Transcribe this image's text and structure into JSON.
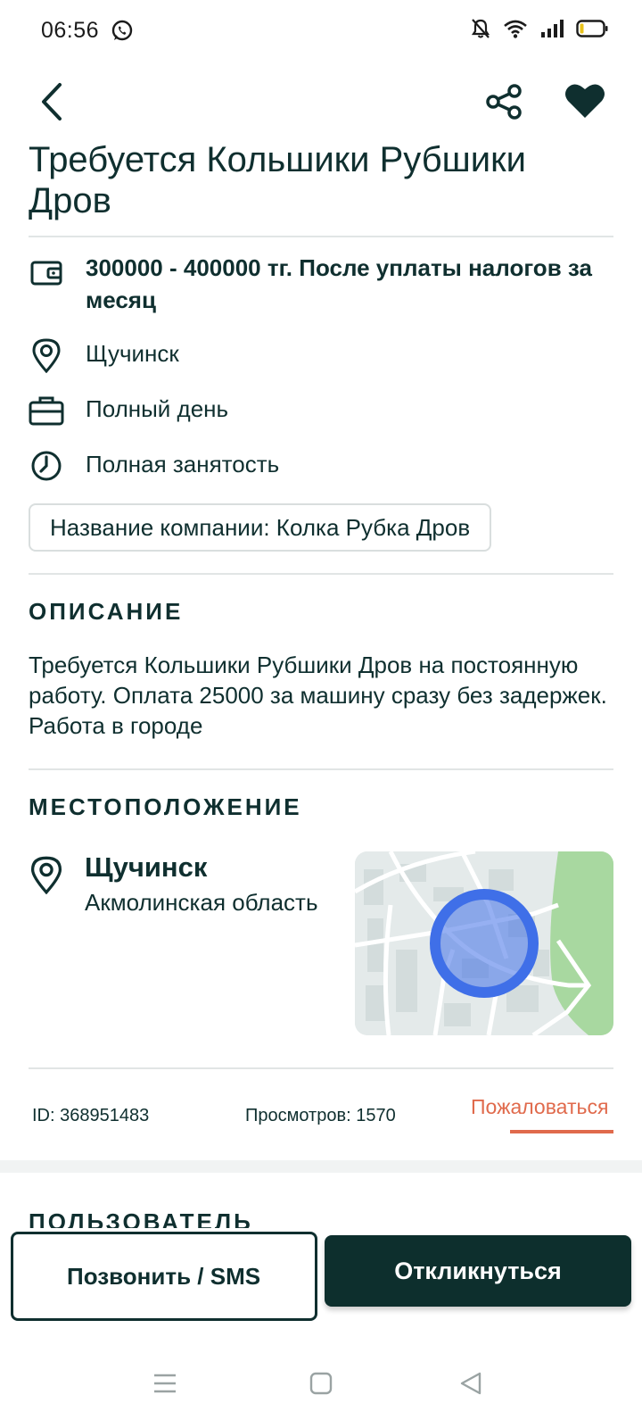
{
  "status_bar": {
    "time": "06:56"
  },
  "job": {
    "title": "Требуется Кольшики Рубшики Дров",
    "salary": "300000 - 400000 тг. После уплаты налогов за месяц",
    "city": "Щучинск",
    "schedule": "Полный день",
    "employment": "Полная занятость",
    "company_chip": "Название компании: Колка Рубка Дров"
  },
  "description": {
    "heading": "ОПИСАНИЕ",
    "text": "Требуется Кольшики Рубшики Дров на постоянную работу. Оплата 25000 за машину сразу без задержек. Работа в городе"
  },
  "location": {
    "heading": "МЕСТОПОЛОЖЕНИЕ",
    "city": "Щучинск",
    "region": "Акмолинская область"
  },
  "meta": {
    "id": "ID: 368951483",
    "views": "Просмотров: 1570",
    "report": "Пожаловаться"
  },
  "user_section": {
    "heading": "ПОЛЬЗОВАТЕЛЬ"
  },
  "actions": {
    "call": "Позвонить / SMS",
    "apply": "Откликнуться"
  },
  "colors": {
    "primary": "#0d2f2d",
    "accent": "#e06a4c",
    "map_marker": "#3f6fe8",
    "map_park": "#a8d8a0"
  },
  "icons": {
    "back": "chevron-left-icon",
    "share": "share-icon",
    "favorite": "heart-icon",
    "salary": "wallet-icon",
    "city": "map-pin-icon",
    "schedule": "briefcase-icon",
    "employment": "clock-icon"
  }
}
